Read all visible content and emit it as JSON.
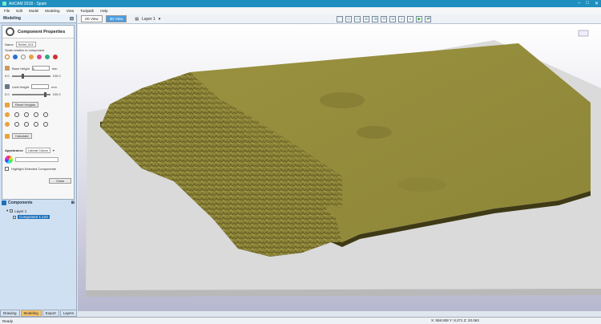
{
  "window": {
    "title": "ArtCAM 2018 - Spain"
  },
  "menu": [
    "File",
    "Edit",
    "Model",
    "Modeling",
    "View",
    "Toolpath",
    "Help"
  ],
  "panel": {
    "title": "Modeling"
  },
  "props": {
    "title": "Component Properties",
    "name_label": "Name",
    "name_value": "Relief_001",
    "scale_label": "Scale relative to component",
    "base_height_label": "Base Height",
    "base_height_value": "0",
    "base_unit": "mm",
    "slider1_value": "100.0",
    "limit_height_label": "Limit Height",
    "limit_unit": "mm",
    "slider2_value": "100.0",
    "reset_label": "Reset Heights",
    "calc_label": "Calculate",
    "appearance_label": "Appearance",
    "appearance_value": "Lateral Colors",
    "highlight_label": "Highlight Selected Components",
    "close_label": "Close"
  },
  "components": {
    "title": "Components",
    "layer": "Layer 1",
    "item": "Component 1:123"
  },
  "tabs": [
    "Drawing",
    "Modeling",
    "Export",
    "Layers"
  ],
  "active_tab": "Modeling",
  "viewtabs": [
    "2D View",
    "3D View"
  ],
  "layer_label": "Layer 1",
  "status": {
    "ready": "Ready",
    "coords": "X: 558.938  Y: 8.271  Z: 20.063"
  },
  "colors": {
    "accent": "#1f8fbf",
    "terrain": "#8a8236",
    "terrain_light": "#a89f4e",
    "terrain_dark": "#4a441a",
    "base": "#dcdcdc"
  }
}
